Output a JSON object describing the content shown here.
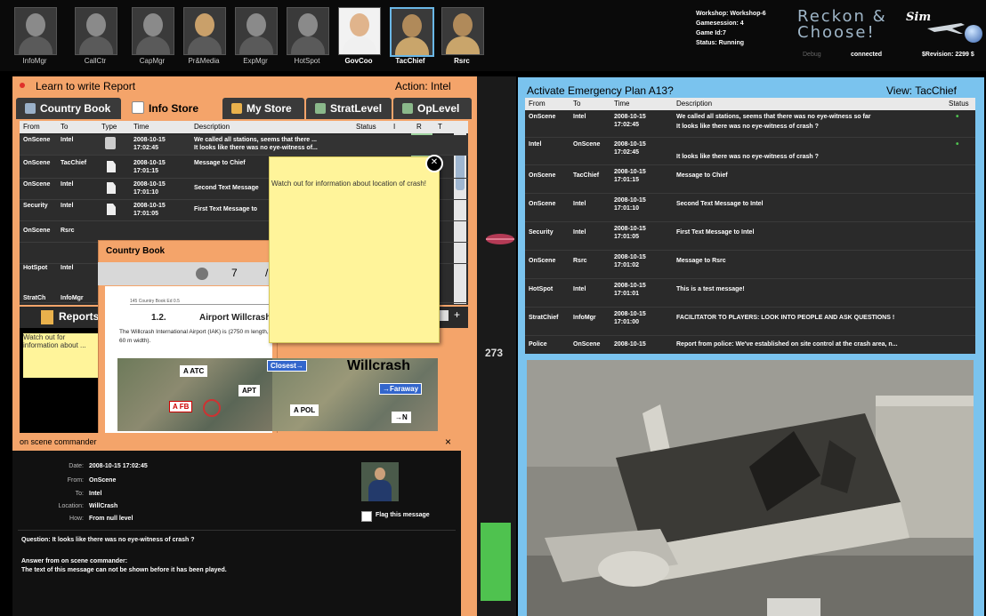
{
  "roles": [
    {
      "name": "InfoMgr",
      "active": false
    },
    {
      "name": "CallCtr",
      "active": false
    },
    {
      "name": "CapMgr",
      "active": false
    },
    {
      "name": "Pr&Media",
      "active": false
    },
    {
      "name": "ExpMgr",
      "active": false
    },
    {
      "name": "HotSpot",
      "active": false
    },
    {
      "name": "GovCoo",
      "active": true
    },
    {
      "name": "TacChief",
      "active": true
    },
    {
      "name": "Rsrc",
      "active": true
    }
  ],
  "session": {
    "workshop": "Workshop: Workshop-6",
    "gamesession": "Gamesession: 4",
    "game_id": "Game Id:7",
    "status": "Status: Running",
    "debug": "Debug",
    "connection": "connected",
    "revision": "$Revision: 2299 $"
  },
  "logo": {
    "line1": "Reckon &",
    "line2": "Choose!",
    "sim": "Sim"
  },
  "left_panel": {
    "title": "Learn to write Report",
    "action": "Action:  Intel",
    "tabs": [
      "Country Book",
      "Info Store",
      "My Store",
      "StratLevel",
      "OpLevel"
    ],
    "table_headers": [
      "From",
      "To",
      "Type",
      "Time",
      "Description",
      "Status",
      "I",
      "R",
      "T"
    ],
    "rows": [
      {
        "from": "OnScene",
        "to": "Intel",
        "date": "2008-10-15",
        "time": "17:02:45",
        "desc1": "We called all stations, seems that there ...",
        "desc2": "It looks like there was no eye-witness of..."
      },
      {
        "from": "OnScene",
        "to": "TacChief",
        "date": "2008-10-15",
        "time": "17:01:15",
        "desc1": "Message to Chief",
        "desc2": ""
      },
      {
        "from": "OnScene",
        "to": "Intel",
        "date": "2008-10-15",
        "time": "17:01:10",
        "desc1": "Second Text Message",
        "desc2": ""
      },
      {
        "from": "Security",
        "to": "Intel",
        "date": "2008-10-15",
        "time": "17:01:05",
        "desc1": "First Text Message to",
        "desc2": ""
      },
      {
        "from": "OnScene",
        "to": "Rsrc",
        "date": "",
        "time": "",
        "desc1": "",
        "desc2": ""
      },
      {
        "from": "HotSpot",
        "to": "Intel",
        "date": "",
        "time": "",
        "desc1": "",
        "desc2": ""
      },
      {
        "from": "StratCh",
        "to": "InfoMgr",
        "date": "",
        "time": "",
        "desc1": "",
        "desc2": ""
      }
    ],
    "reports_label": "Reports",
    "report_note": "Watch out for information about ..."
  },
  "sticky": {
    "text": "Watch out for information about location of crash!"
  },
  "country_book": {
    "title": "Country Book",
    "page": "7",
    "slash": "/",
    "caption": "145 Country Book Ed 0.5",
    "section_num": "1.2.",
    "section_title": "Airport Willcrash",
    "body": "The Willcrash International Airport (IAK) is (2750 m length, 60 m width).",
    "map_labels": {
      "atc": "A ATC",
      "apt": "APT",
      "fb": "A FB",
      "pol": "A POL",
      "closest": "Closest→",
      "faraway": "→Faraway",
      "n": "→N",
      "place": "Willcrash"
    }
  },
  "commander": {
    "title": "on scene commander",
    "close": "×",
    "date_label": "Date:",
    "date": "2008-10-15 17:02:45",
    "from_label": "From:",
    "from": "OnScene",
    "to_label": "To:",
    "to": "Intel",
    "location_label": "Location:",
    "location": "WillCrash",
    "how_label": "How:",
    "how": "From null level",
    "flag_label": "Flag this message",
    "question": "Question: It looks like there was no eye-witness of crash ?",
    "answer_title": "Answer from on scene commander:",
    "answer": "The text of this message can not be shown before it has been played."
  },
  "middle": {
    "counter": "273"
  },
  "right_panel": {
    "title": "Activate Emergency Plan A13?",
    "view": "View:   TacChief",
    "table_headers": [
      "From",
      "To",
      "Time",
      "Description",
      "Status"
    ],
    "rows": [
      {
        "from": "OnScene",
        "to": "Intel",
        "date": "2008-10-15",
        "time": "17:02:45",
        "desc1": "We called all stations, seems that there was no eye-witness so far",
        "desc2": "It looks like there was no eye-witness of crash ?",
        "status": "•"
      },
      {
        "from": "Intel",
        "to": "OnScene",
        "date": "2008-10-15",
        "time": "17:02:45",
        "desc1": "",
        "desc2": "It looks like there was no eye-witness of crash ?",
        "status": "•"
      },
      {
        "from": "OnScene",
        "to": "TacChief",
        "date": "2008-10-15",
        "time": "17:01:15",
        "desc1": "Message to Chief",
        "desc2": "",
        "status": ""
      },
      {
        "from": "OnScene",
        "to": "Intel",
        "date": "2008-10-15",
        "time": "17:01:10",
        "desc1": "Second Text Message to Intel",
        "desc2": "",
        "status": ""
      },
      {
        "from": "Security",
        "to": "Intel",
        "date": "2008-10-15",
        "time": "17:01:05",
        "desc1": "First Text Message to Intel",
        "desc2": "",
        "status": ""
      },
      {
        "from": "OnScene",
        "to": "Rsrc",
        "date": "2008-10-15",
        "time": "17:01:02",
        "desc1": "Message to Rsrc",
        "desc2": "",
        "status": ""
      },
      {
        "from": "HotSpot",
        "to": "Intel",
        "date": "2008-10-15",
        "time": "17:01:01",
        "desc1": "This is a test message!",
        "desc2": "",
        "status": ""
      },
      {
        "from": "StratChief",
        "to": "InfoMgr",
        "date": "2008-10-15",
        "time": "17:01:00",
        "desc1": "FACILITATOR TO PLAYERS: LOOK INTO PEOPLE AND ASK QUESTIONS !",
        "desc2": "",
        "status": ""
      },
      {
        "from": "Police",
        "to": "OnScene",
        "date": "2008-10-15",
        "time": "",
        "desc1": "Report from police: We've established on site control at the crash area, n...",
        "desc2": "",
        "status": ""
      }
    ]
  },
  "colors": {
    "accent_orange": "#f4a46a",
    "accent_blue": "#7ac3ee",
    "sticky_yellow": "#fff49a",
    "status_green": "#4fc24f"
  }
}
